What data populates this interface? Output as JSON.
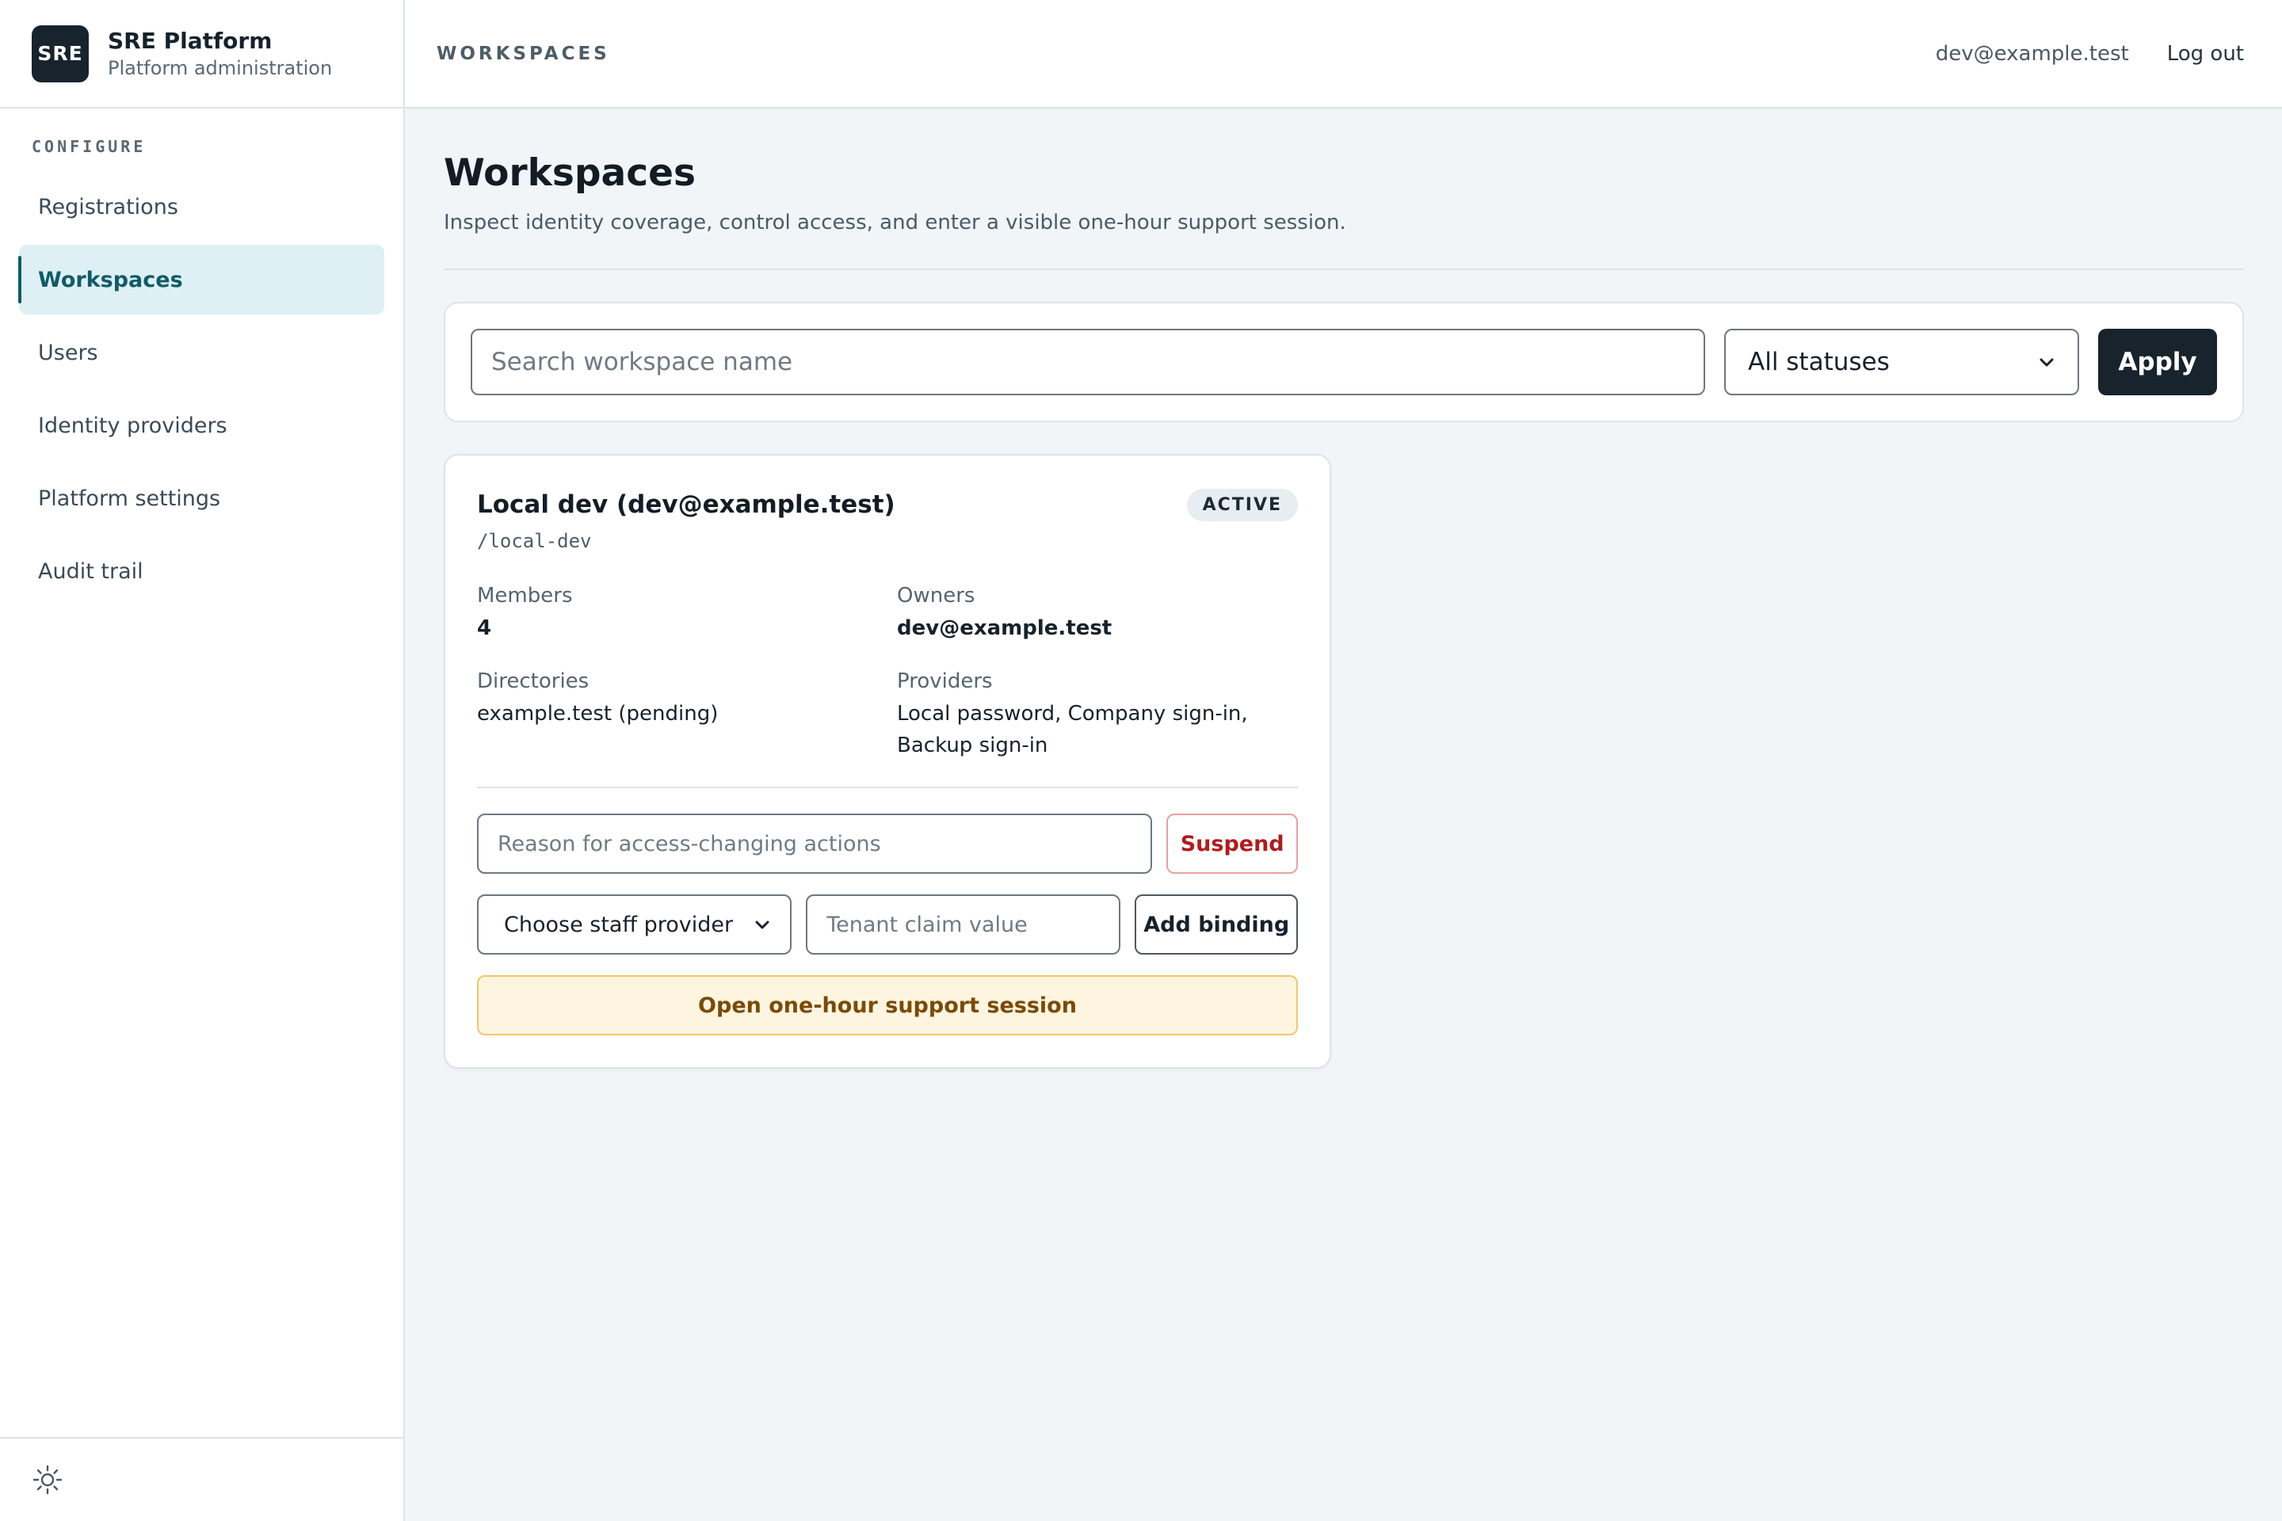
{
  "brand": {
    "logo_text": "SRE",
    "title": "SRE Platform",
    "subtitle": "Platform administration"
  },
  "sidebar": {
    "section_label": "CONFIGURE",
    "items": [
      {
        "label": "Registrations",
        "active": false
      },
      {
        "label": "Workspaces",
        "active": true
      },
      {
        "label": "Users",
        "active": false
      },
      {
        "label": "Identity providers",
        "active": false
      },
      {
        "label": "Platform settings",
        "active": false
      },
      {
        "label": "Audit trail",
        "active": false
      }
    ],
    "footer_icon": "sun-icon"
  },
  "topbar": {
    "title": "WORKSPACES",
    "user_email": "dev@example.test",
    "logout_label": "Log out"
  },
  "page": {
    "title": "Workspaces",
    "description": "Inspect identity coverage, control access, and enter a visible one-hour support session."
  },
  "filters": {
    "search_placeholder": "Search workspace name",
    "search_value": "",
    "status_selected": "All statuses",
    "apply_label": "Apply"
  },
  "workspace": {
    "name": "Local dev (dev@example.test)",
    "slug": "/local-dev",
    "status": "ACTIVE",
    "members_label": "Members",
    "members_value": "4",
    "owners_label": "Owners",
    "owners_value": "dev@example.test",
    "directories_label": "Directories",
    "directories_value": "example.test (pending)",
    "providers_label": "Providers",
    "providers_value": "Local password, Company sign-in, Backup sign-in",
    "reason_placeholder": "Reason for access-changing actions",
    "suspend_label": "Suspend",
    "provider_select_selected": "Choose staff provider",
    "claim_placeholder": "Tenant claim value",
    "add_binding_label": "Add binding",
    "support_label": "Open one-hour support session"
  },
  "colors": {
    "accent": "#0f5c68",
    "active_nav_bg": "#dff0f4",
    "dark": "#17232d",
    "danger": "#b01c1c",
    "warning_bg": "#fdf5df",
    "warning_text": "#7b4a07",
    "page_bg": "#f1f5f8"
  }
}
